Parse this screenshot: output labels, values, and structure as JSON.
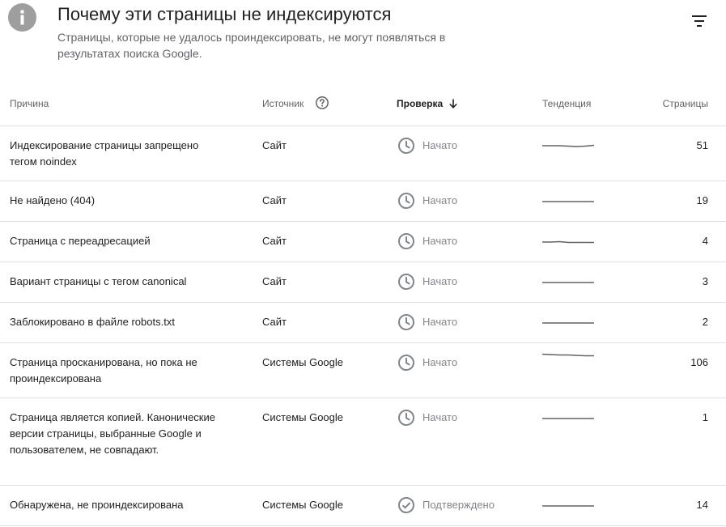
{
  "header": {
    "info_icon": "info-icon",
    "title": "Почему эти страницы не индексируются",
    "subtitle": "Страницы, которые не удалось проиндексировать, не могут появляться в результатах поиска Google.",
    "filter_icon": "filter-icon"
  },
  "table": {
    "columns": {
      "reason": "Причина",
      "source": "Источник",
      "check": "Проверка",
      "trend": "Тенденция",
      "pages": "Страницы"
    },
    "help_icon": "help-icon",
    "sort_icon": "arrow-down-icon",
    "rows": [
      {
        "reason": "Индексирование страницы запрещено тегом noindex",
        "source": "Сайт",
        "status": "Начато",
        "status_icon": "clock-icon",
        "trend": [
          12,
          12,
          12,
          12.5,
          13,
          12.5,
          11.5
        ],
        "pages": "51"
      },
      {
        "reason": "Не найдено (404)",
        "source": "Сайт",
        "status": "Начато",
        "status_icon": "clock-icon",
        "trend": [
          13,
          13,
          13,
          13,
          13,
          13,
          13
        ],
        "pages": "19"
      },
      {
        "reason": "Страница с переадресацией",
        "source": "Сайт",
        "status": "Начато",
        "status_icon": "clock-icon",
        "trend": [
          13,
          13,
          12.5,
          13.5,
          13.5,
          13.5,
          13.5
        ],
        "pages": "4"
      },
      {
        "reason": "Вариант страницы с тегом canonical",
        "source": "Сайт",
        "status": "Начато",
        "status_icon": "clock-icon",
        "trend": [
          13,
          13,
          13,
          13,
          13,
          13,
          13
        ],
        "pages": "3"
      },
      {
        "reason": "Заблокировано в файле robots.txt",
        "source": "Сайт",
        "status": "Начато",
        "status_icon": "clock-icon",
        "trend": [
          13,
          13,
          13,
          13,
          13,
          13,
          13
        ],
        "pages": "2"
      },
      {
        "reason": "Страница просканирована, но пока не проиндексирована",
        "source": "Системы Google",
        "status": "Начато",
        "status_icon": "clock-icon",
        "trend": [
          1.5,
          2,
          2.5,
          2.5,
          3,
          3.5,
          3.5
        ],
        "pages": "106"
      },
      {
        "reason": "Страница является копией. Канонические версии страницы, выбранные Google и пользователем, не совпадают.",
        "source": "Системы Google",
        "status": "Начато",
        "status_icon": "clock-icon",
        "trend": [
          13,
          13,
          13,
          13,
          13,
          13,
          13
        ],
        "pages": "1"
      },
      {
        "reason": "Обнаружена, не проиндексирована",
        "source": "Системы Google",
        "status": "Подтверждено",
        "status_icon": "check-circle-icon",
        "trend": [
          13,
          13,
          13,
          13,
          13,
          13,
          13
        ],
        "pages": "14"
      }
    ]
  }
}
